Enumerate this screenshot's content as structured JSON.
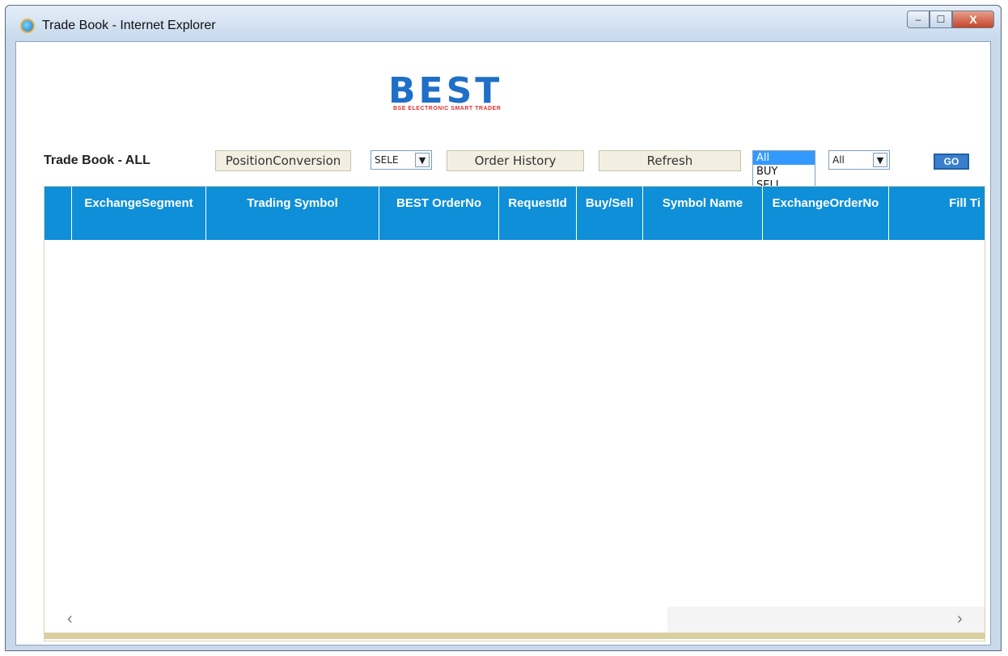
{
  "window": {
    "title": "Trade Book - Internet Explorer",
    "controls": {
      "min": "–",
      "max": "☐",
      "close": "X"
    }
  },
  "logo": {
    "text": "BEST",
    "tagline": "BSE ELECTRONIC SMART TRADER"
  },
  "toolbar": {
    "title": "Trade Book - ALL",
    "position_conversion": "PositionConversion",
    "select1_value": "SELE",
    "order_history": "Order History",
    "refresh": "Refresh",
    "filter_options": [
      "All",
      "BUY",
      "SELL"
    ],
    "select3_value": "All",
    "go": "GO"
  },
  "table": {
    "columns": [
      "",
      "ExchangeSegment",
      "Trading Symbol",
      "BEST OrderNo",
      "RequestId",
      "Buy/Sell",
      "Symbol Name",
      "ExchangeOrderNo",
      "Fill Ti"
    ]
  },
  "scroll": {
    "left": "‹",
    "right": "›"
  },
  "colors": {
    "header": "#0f8fd8",
    "button": "#f2efe2",
    "accent": "#3399ff"
  }
}
